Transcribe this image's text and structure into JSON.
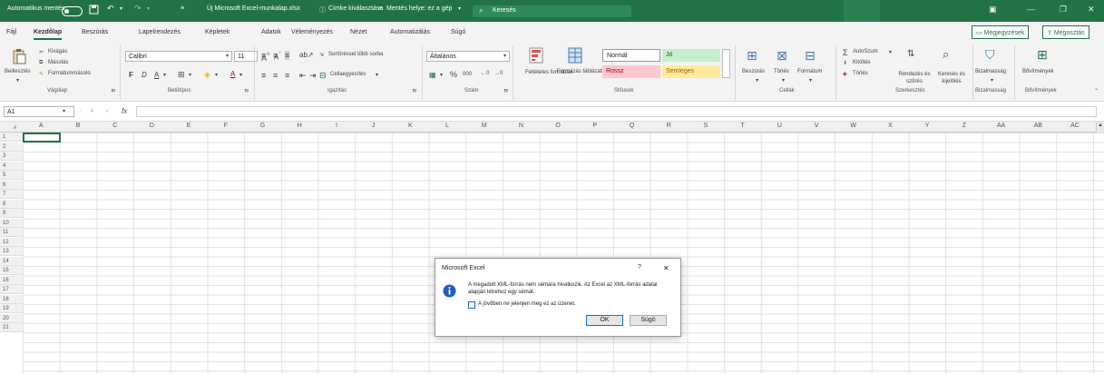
{
  "titlebar": {
    "autosave": "Automatikus mentés",
    "doc_title": "Új Microsoft Excel-munkalap.xlsx",
    "sensitivity": "Címke kiválasztása",
    "save_location": "Mentés helye: ez a gép",
    "search_placeholder": "Keresés",
    "accent": "#217346"
  },
  "tabs": [
    {
      "label": "Fájl"
    },
    {
      "label": "Kezdőlap"
    },
    {
      "label": "Beszúrás"
    },
    {
      "label": "Lapelrendezés"
    },
    {
      "label": "Képletek"
    },
    {
      "label": "Adatok"
    },
    {
      "label": "Véleményezés"
    },
    {
      "label": "Nézet"
    },
    {
      "label": "Automatizálás"
    },
    {
      "label": "Súgó"
    }
  ],
  "topright": {
    "comments": "Megjegyzések",
    "share": "Megosztás"
  },
  "ribbon": {
    "clipboard": {
      "paste": "Beillesztés",
      "cut": "Kivágás",
      "copy": "Másolás",
      "painter": "Formátummásoló",
      "group": "Vágólap"
    },
    "font": {
      "name": "Calibri",
      "size": "11",
      "bold": "F",
      "italic": "D",
      "underline": "A",
      "group": "Betűtípus"
    },
    "alignment": {
      "wrap": "Sortöréssel több sorba",
      "merge": "Cellaegyesítés",
      "group": "Igazítás"
    },
    "number": {
      "format": "Általános",
      "percent": "%",
      "thousands": "000",
      "group": "Szám"
    },
    "styles": {
      "conditional": "Feltételes formázás",
      "table": "Formázás táblázatként",
      "normal": "Normál",
      "good": "Jó",
      "bad": "Rossz",
      "neutral": "Semleges",
      "group": "Stílusok"
    },
    "cells": {
      "insert": "Beszúrás",
      "delete": "Törlés",
      "format": "Formátum",
      "group": "Cellák"
    },
    "editing": {
      "autosum": "AutoSzum",
      "fill": "Kitöltés",
      "clear": "Törlés",
      "sort": "Rendezés és szűrés",
      "find": "Keresés és kijelölés",
      "group": "Szerkesztés"
    },
    "sensitivity": {
      "label": "Bizalmasság",
      "group": "Bizalmasság"
    },
    "addins": {
      "label": "Bővítmények",
      "group": "Bővítmények"
    },
    "style_colors": {
      "good_bg": "#c6efce",
      "good_fg": "#006100",
      "bad_bg": "#ffc7ce",
      "bad_fg": "#9c0006",
      "neutral_bg": "#ffeb9c",
      "neutral_fg": "#9c5700"
    }
  },
  "formula_bar": {
    "name_box": "A1",
    "fx": "fx"
  },
  "columns": [
    "A",
    "B",
    "C",
    "D",
    "E",
    "F",
    "G",
    "H",
    "I",
    "J",
    "K",
    "L",
    "M",
    "N",
    "O",
    "P",
    "Q",
    "R",
    "S",
    "T",
    "U",
    "V",
    "W",
    "X",
    "Y",
    "Z",
    "AA",
    "AB",
    "AC"
  ],
  "rows": [
    "1",
    "2",
    "3",
    "4",
    "5",
    "6",
    "7",
    "8",
    "9",
    "10",
    "11",
    "12",
    "13",
    "14",
    "15",
    "16",
    "17",
    "18",
    "19",
    "20",
    "21"
  ],
  "dialog": {
    "title": "Microsoft Excel",
    "help": "?",
    "close": "✕",
    "message": "A megadott XML-forrás nem sémára hivatkozik. Az Excel az XML-forrás adatai alapján létrehoz egy sémát.",
    "checkbox": "A jövőben ne jelenjen meg ez az üzenet.",
    "ok": "OK",
    "help_button": "Súgó"
  }
}
